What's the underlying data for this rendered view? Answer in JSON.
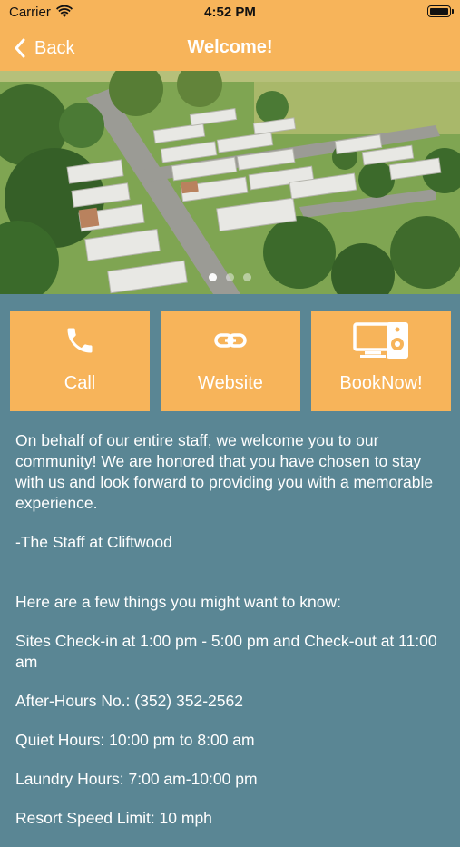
{
  "status_bar": {
    "carrier": "Carrier",
    "time": "4:52 PM"
  },
  "nav": {
    "back_label": "Back",
    "title": "Welcome!"
  },
  "hero": {
    "image_description": "aerial-photo",
    "pages": 3,
    "active_page": 1
  },
  "actions": [
    {
      "label": "Call",
      "icon": "phone-icon"
    },
    {
      "label": "Website",
      "icon": "link-icon"
    },
    {
      "label": "BookNow!",
      "icon": "booking-devices-icon"
    }
  ],
  "content": {
    "intro": "On behalf of our entire staff, we welcome you to our community! We are honored that you have chosen to stay with us and look forward to providing you with a memorable experience.",
    "signature": "-The Staff at Cliftwood",
    "things_heading": "Here are a few things you might want to know:",
    "check_in": "Sites Check-in at 1:00 pm - 5:00 pm and Check-out at 11:00 am",
    "after_hours": "After-Hours No.: (352) 352-2562",
    "quiet_hours": "Quiet Hours: 10:00 pm to 8:00 am",
    "laundry_hours": "Laundry Hours: 7:00 am-10:00 pm",
    "speed_limit": "Resort Speed Limit: 10 mph"
  },
  "colors": {
    "accent": "#f7b45a",
    "background": "#5a8694",
    "text": "#ffffff"
  }
}
